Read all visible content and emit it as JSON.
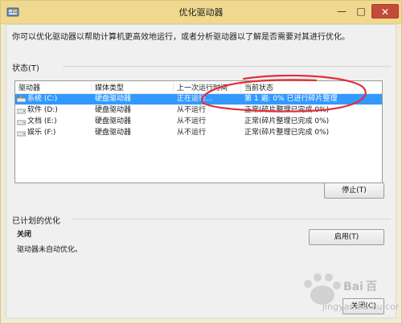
{
  "window": {
    "title": "优化驱动器",
    "minimize_glyph": "—",
    "maximize_glyph": "□",
    "close_glyph": "✕"
  },
  "intro_text": "你可以优化驱动器以帮助计算机更高效地运行，或者分析驱动器以了解是否需要对其进行优化。",
  "status": {
    "section_label": "状态(T)",
    "columns": [
      "驱动器",
      "媒体类型",
      "上一次运行时间",
      "当前状态"
    ],
    "rows": [
      {
        "drive": "系统 (C:)",
        "media": "硬盘驱动器",
        "last_run": "正在运行...",
        "status": "第 1 遍: 0% 已进行碎片整理",
        "selected": true,
        "icon": "system-drive-icon"
      },
      {
        "drive": "软件 (D:)",
        "media": "硬盘驱动器",
        "last_run": "从不运行",
        "status": "正常(碎片整理已完成 0%)",
        "selected": false,
        "icon": "hard-drive-icon"
      },
      {
        "drive": "文档 (E:)",
        "media": "硬盘驱动器",
        "last_run": "从不运行",
        "status": "正常(碎片整理已完成 0%)",
        "selected": false,
        "icon": "hard-drive-icon"
      },
      {
        "drive": "娱乐 (F:)",
        "media": "硬盘驱动器",
        "last_run": "从不运行",
        "status": "正常(碎片整理已完成 0%)",
        "selected": false,
        "icon": "hard-drive-icon"
      }
    ],
    "stop_button": "停止(T)"
  },
  "scheduled": {
    "section_label": "已计划的优化",
    "state_title": "关闭",
    "state_desc": "驱动器未自动优化。",
    "enable_button": "启用(T)"
  },
  "close_button": "关闭(C)",
  "colors": {
    "titlebar": "#f0d98e",
    "selection": "#3399ff",
    "annotation": "#e0303a"
  }
}
